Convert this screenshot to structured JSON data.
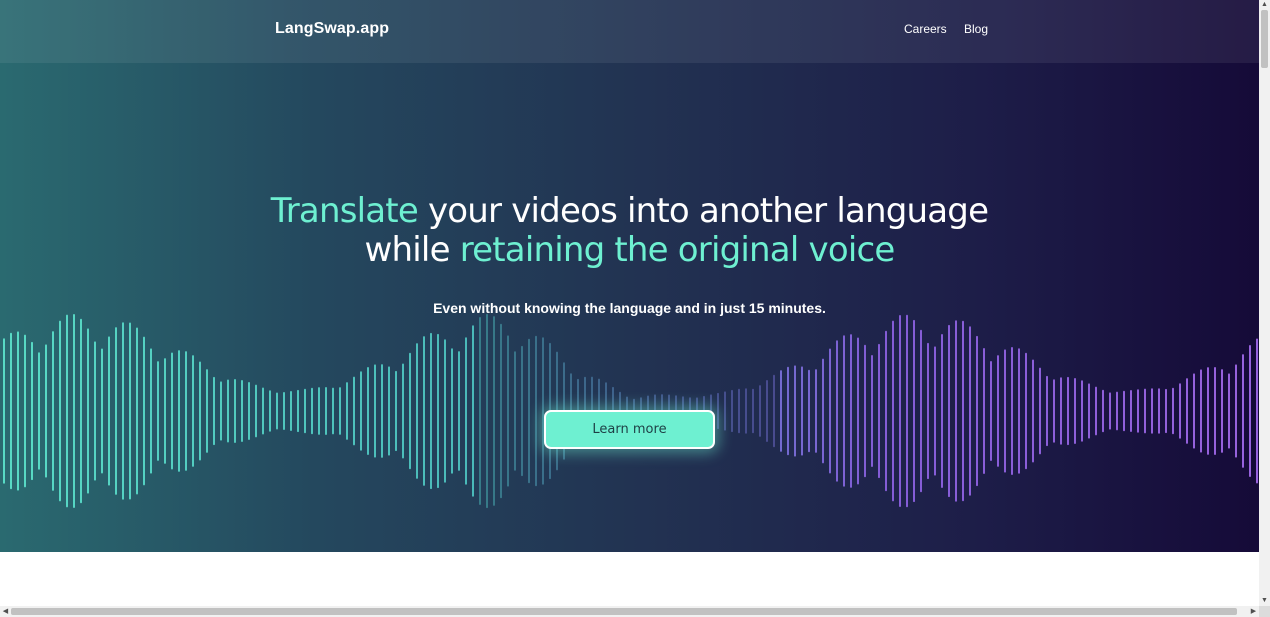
{
  "nav": {
    "brand": "LangSwap.app",
    "links": [
      {
        "label": "Careers"
      },
      {
        "label": "Blog"
      }
    ]
  },
  "hero": {
    "headline": {
      "part1_accent": "Translate",
      "part1_rest": " your videos into another language",
      "part2_lead": "while ",
      "part2_accent": "retaining the original voice"
    },
    "subtitle": "Even without knowing the language and in just 15 minutes.",
    "cta_label": "Learn more"
  },
  "colors": {
    "accent": "#6ef0d1",
    "wave_start": "#5ee8cf",
    "wave_end": "#9b63ec"
  },
  "icons": {
    "scroll_up": "triangle-up-icon",
    "scroll_down": "triangle-down-icon",
    "scroll_left": "triangle-left-icon",
    "scroll_right": "triangle-right-icon"
  }
}
